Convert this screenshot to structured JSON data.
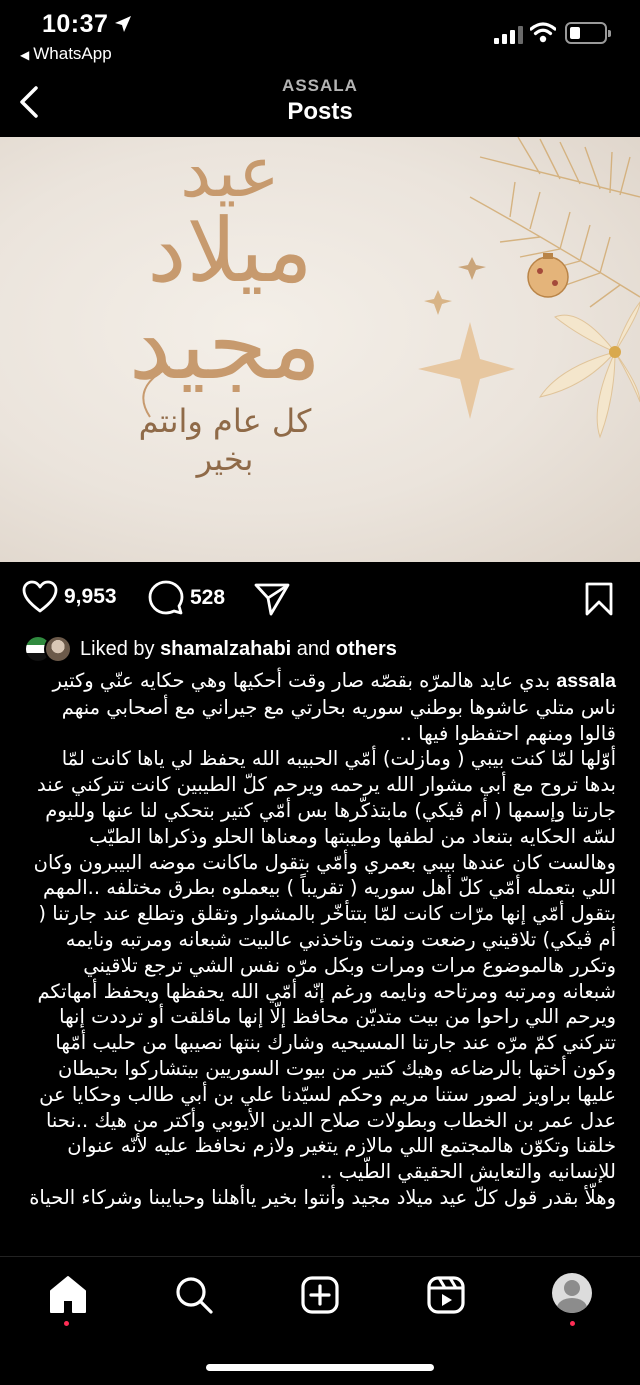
{
  "status_bar": {
    "time": "10:37",
    "back_app": "WhatsApp"
  },
  "header": {
    "account": "ASSALA",
    "title": "Posts"
  },
  "post_image": {
    "greeting_line1": "عيد",
    "greeting_line2": "ميلاد",
    "greeting_line3": "مجيد",
    "greeting_small": "كل عام وانتم بخير"
  },
  "actions": {
    "likes": "9,953",
    "comments": "528"
  },
  "liked_by": {
    "prefix": "Liked by",
    "user": "shamalzahabi",
    "conj": "and",
    "others": "others"
  },
  "caption": {
    "username": "assala",
    "intro": "بدي عايد هالمرّه بقصّه صار وقت أحكيها وهي حكايه عنّي وكتير ناس متلي عاشوها بوطني سوريه بحارتي مع جيراني مع أصحابي منهم قالوا ومنهم احتفظوا فيها ..",
    "body": "أوّلها لمّا كنت بيبي ( ومازلت) أمّي الحبيبه الله يحفظ لي ياها كانت لمّا بدها تروح مع أبي مشوار الله يرحمه ويرحم كلّ الطيبين كانت تتركني عند جارتنا وإسمها ( أم ڤيكي) مابتذكّرها بس أمّي كتير بتحكي لنا عنها ولليوم لسّه الحكايه بتنعاد من لطفها وطيبتها ومعناها الحلو وذكراها الطيّب وهالست كان عندها بيبي بعمري وأمّي بتقول ماكانت موضه البيبرون وكان اللي بتعمله أمّي كلّ أهل سوريه ( تقريباً ) بيعملوه بطرق مختلفه ..المهم بتقول أمّي إنها مرّات كانت لمّا بتتأخّر بالمشوار وتقلق وتطلع عند جارتنا ( أم ڤيكي) تلاقيني رضعت ونمت وتاخذني عالبيت شبعانه ومرتبه ونايمه وتكرر هالموضوع مرات ومرات وبكل مرّه نفس الشي ترجع تلاقيني شبعانه ومرتبه ومرتاحه ونايمه ورغم إنّه أمّي الله يحفظها ويحفظ أمهاتكم ويرحم اللي راحوا من بيت متديّن محافظ إلّا إنها ماقلقت أو ترددت إنها تتركني كمّ مرّه عند جارتنا المسيحيه وشارك بنتها نصيبها من حليب أمّها وكون أختها بالرضاعه وهيك كتير من بيوت السوريين بيتشاركوا بحيطان عليها براويز لصور ستنا مريم وحكم لسيّدنا علي بن أبي طالب وحكايا عن عدل عمر بن الخطاب وبطولات صلاح الدين الأيوبي وأكتر من هيك ..نحنا خلقنا وتكوّن هالمجتمع اللي مالازم يتغير ولازم نحافظ عليه لأنّه عنوان للإنسانيه والتعايش الحقيقي الطّيب ..",
    "closing": "وهلّأ بقدر قول كلّ عيد ميلاد مجيد وأنتوا بخير ياأهلنا وحبايبنا وشركاء الحياة"
  },
  "colors": {
    "background": "#000000",
    "text": "#ffffff",
    "muted": "#b4b4b4",
    "notification_dot": "#ff2d55",
    "gold": "#c79a6e"
  },
  "icons": [
    "location-arrow-icon",
    "signal-icon",
    "wifi-icon",
    "battery-icon",
    "back-chevron-icon",
    "heart-icon",
    "comment-icon",
    "share-icon",
    "bookmark-icon",
    "home-icon",
    "search-icon",
    "create-icon",
    "reels-icon",
    "profile-icon"
  ]
}
